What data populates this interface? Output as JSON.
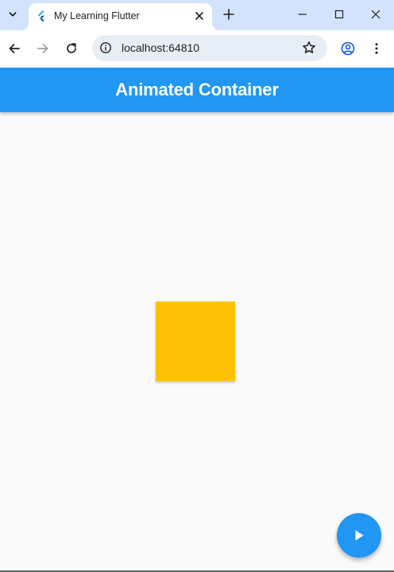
{
  "browser": {
    "tab": {
      "title": "My Learning Flutter",
      "favicon": "flutter-logo-icon"
    },
    "address_bar": {
      "url": "localhost:64810"
    },
    "colors": {
      "tabstrip": "#d3e3fd",
      "omnibox": "#e9eef6"
    }
  },
  "app": {
    "title": "Animated Container",
    "box_color": "#ffc107",
    "fab_icon": "play-arrow-icon",
    "colors": {
      "primary": "#2196f3",
      "background": "#fafafa"
    }
  }
}
